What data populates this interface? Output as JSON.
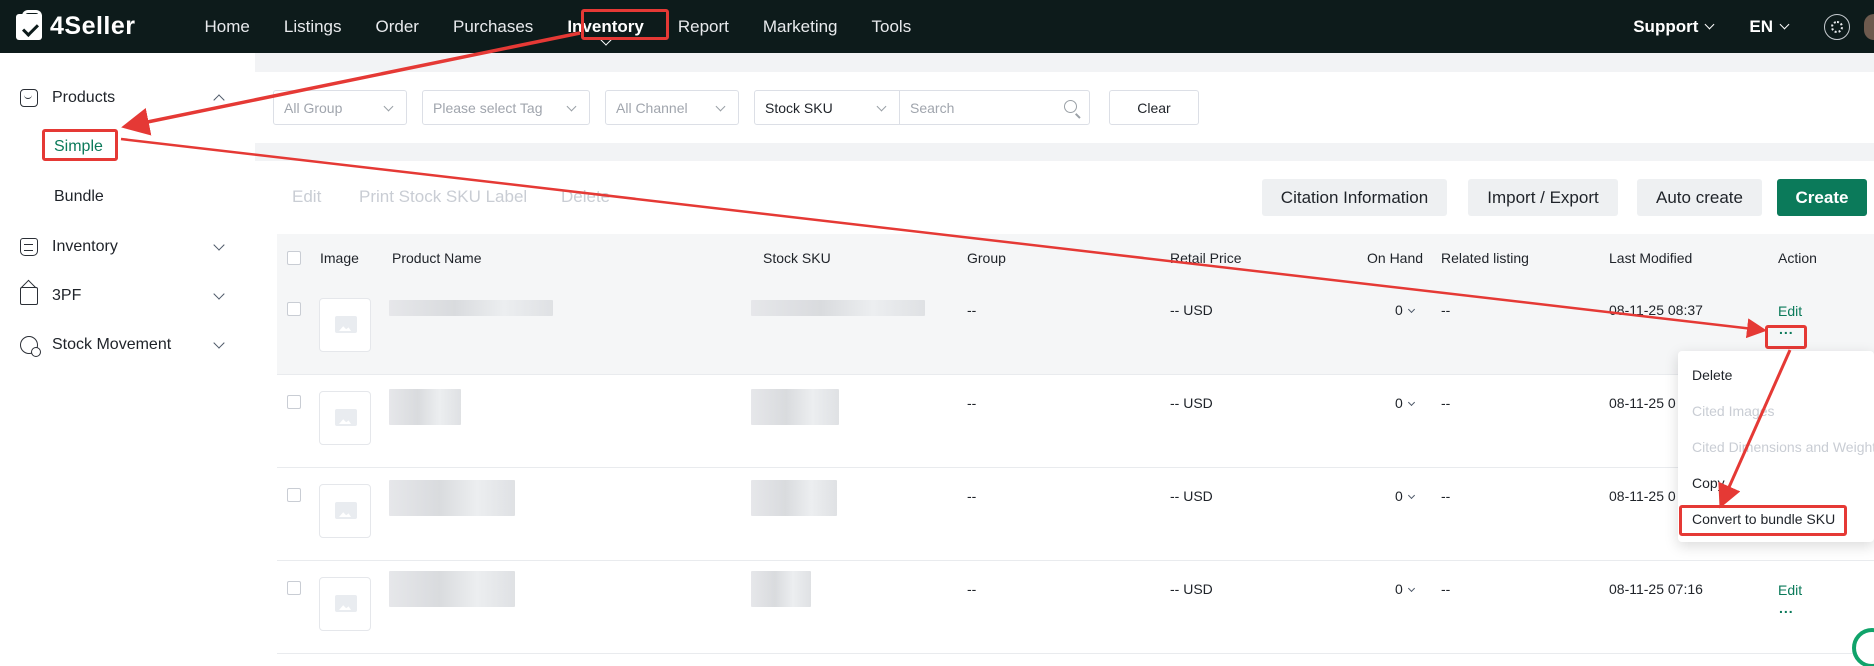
{
  "brand": {
    "name": "4Seller"
  },
  "nav": {
    "items": [
      "Home",
      "Listings",
      "Order",
      "Purchases",
      "Inventory",
      "Report",
      "Marketing",
      "Tools"
    ],
    "active_index": 4
  },
  "top_right": {
    "support": "Support",
    "language": "EN"
  },
  "sidebar": {
    "products": {
      "label": "Products",
      "expanded": true,
      "children": [
        "Simple",
        "Bundle"
      ],
      "active_child": 0
    },
    "sections": [
      "Inventory",
      "3PF",
      "Stock Movement"
    ]
  },
  "filters": {
    "group": "All Group",
    "tag": "Please select Tag",
    "channel": "All Channel",
    "search_field": "Stock SKU",
    "search_placeholder": "Search",
    "clear": "Clear"
  },
  "toolbar": {
    "edit": "Edit",
    "print_label": "Print Stock SKU Label",
    "delete": "Delete",
    "citation": "Citation Information",
    "import_export": "Import / Export",
    "auto_create": "Auto create",
    "create": "Create"
  },
  "table": {
    "headers": {
      "image": "Image",
      "product_name": "Product Name",
      "stock_sku": "Stock SKU",
      "group": "Group",
      "retail_price": "Retail Price",
      "on_hand": "On Hand",
      "related_listing": "Related listing",
      "last_modified": "Last Modified",
      "action": "Action"
    },
    "rows": [
      {
        "group": "--",
        "retail_price": "-- USD",
        "on_hand": "0",
        "related_listing": "--",
        "last_modified": "08-11-25 08:37",
        "edit": "Edit",
        "more": "..."
      },
      {
        "group": "--",
        "retail_price": "-- USD",
        "on_hand": "0",
        "related_listing": "--",
        "last_modified": "08-11-25 0",
        "edit": "",
        "more": ""
      },
      {
        "group": "--",
        "retail_price": "-- USD",
        "on_hand": "0",
        "related_listing": "--",
        "last_modified": "08-11-25 0",
        "edit": "",
        "more": ""
      },
      {
        "group": "--",
        "retail_price": "-- USD",
        "on_hand": "0",
        "related_listing": "--",
        "last_modified": "08-11-25 07:16",
        "edit": "Edit",
        "more": "..."
      }
    ]
  },
  "row_menu": {
    "items": [
      "Delete",
      "Cited Images",
      "Cited Dimensions and Weight",
      "Copy",
      "Convert to bundle SKU"
    ],
    "disabled": [
      false,
      true,
      true,
      false,
      false
    ]
  },
  "colors": {
    "brand": "#0b7a5a",
    "topbar": "#0d1b1b",
    "annotation": "#e53935"
  }
}
